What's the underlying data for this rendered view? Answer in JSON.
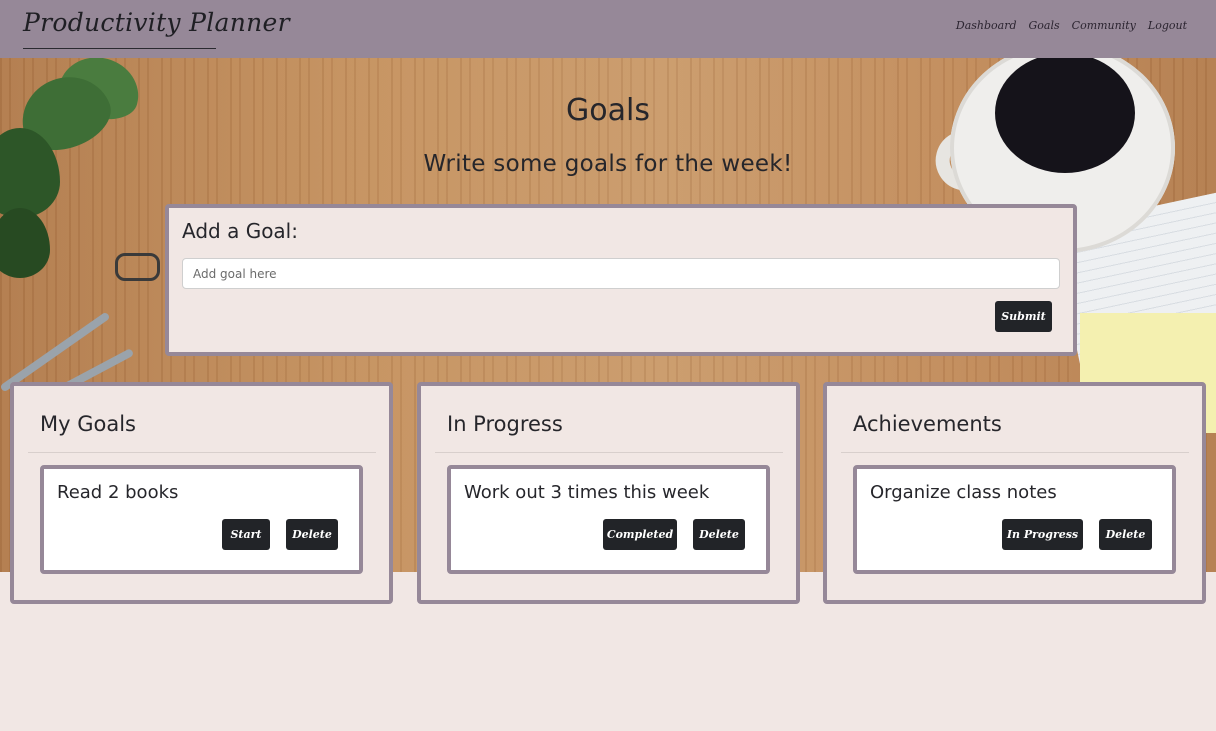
{
  "navbar": {
    "brand": "Productivity Planner",
    "links": [
      "Dashboard",
      "Goals",
      "Community",
      "Logout"
    ]
  },
  "header": {
    "title": "Goals",
    "subtitle": "Write some goals for the week!"
  },
  "add_goal": {
    "title": "Add a Goal:",
    "input_placeholder": "Add goal here",
    "input_value": "",
    "submit_label": "Submit"
  },
  "columns": [
    {
      "title": "My Goals",
      "goal": "Read 2 books",
      "actions": [
        "Start",
        "Delete"
      ]
    },
    {
      "title": "In Progress",
      "goal": "Work out 3 times this week",
      "actions": [
        "Completed",
        "Delete"
      ]
    },
    {
      "title": "Achievements",
      "goal": "Organize class notes",
      "actions": [
        "In Progress",
        "Delete"
      ]
    }
  ],
  "colors": {
    "navbar": "#968898",
    "page_background": "#f1e7e4",
    "button": "#222428",
    "card_border": "#968898"
  }
}
